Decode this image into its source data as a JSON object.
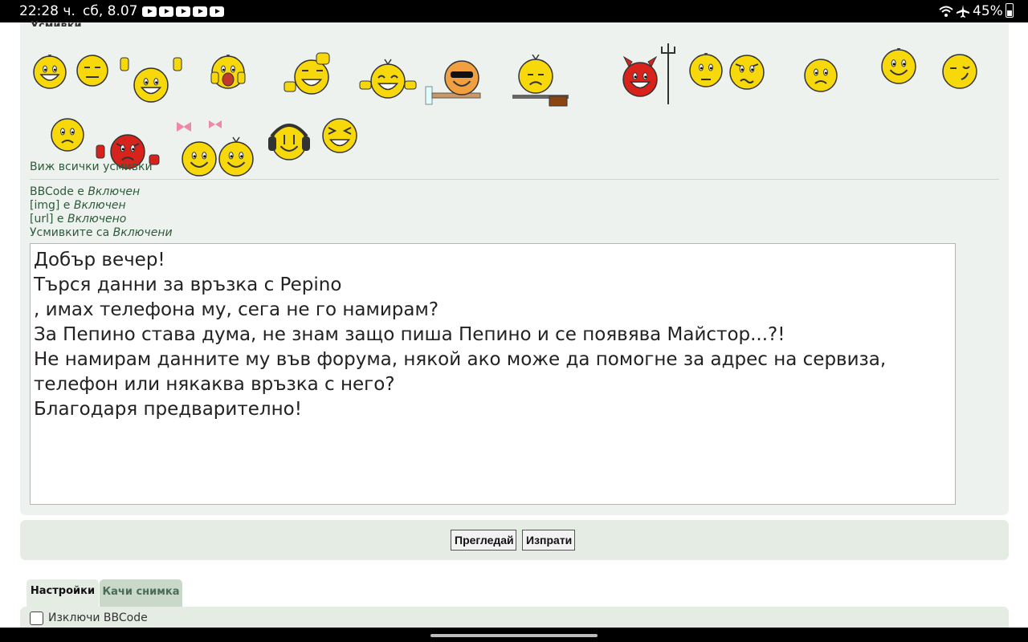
{
  "status_bar": {
    "time": "22:28 ч.",
    "date": "сб, 8.07",
    "battery": "45%",
    "icons": [
      "youtube-icon",
      "youtube-icon",
      "youtube-icon",
      "youtube-icon",
      "youtube-icon",
      "wifi-icon",
      "airplane-icon",
      "battery-icon"
    ]
  },
  "smilies": {
    "title": "Усмивки",
    "view_all": "Виж всички усмивки"
  },
  "bbcode": {
    "bbcode_prefix": "BBCode е ",
    "bbcode_value": "Включен",
    "img_prefix": "[img] е ",
    "img_value": "Включен",
    "url_prefix": "[url] е ",
    "url_value": "Включено",
    "smilies_prefix": "Усмивките са ",
    "smilies_value": "Включени"
  },
  "message": "Добър вечер!\nТърся данни за връзка с Pepino\n, имах телефона му, сега не го намирам?\nЗа Пепино става дума, не знам защо пиша Пепино и се появява Майстор...?!\nНе намирам данните му във форума, някой ако може да помогне за адрес на сервиза,\nтелефон или някаква връзка с него?\nБлагодаря предварително!",
  "buttons": {
    "preview": "Прегледай",
    "submit": "Изпрати"
  },
  "tabs": [
    {
      "label": "Настройки",
      "active": true
    },
    {
      "label": "Качи снимка",
      "active": false
    }
  ],
  "options": {
    "disable_bbcode": "Изключи BBCode"
  },
  "colors": {
    "panel": "#eef2ee",
    "link_green": "#2e5a3b",
    "smiley_yellow": "#f7d80b",
    "devil_red": "#d8231c"
  }
}
